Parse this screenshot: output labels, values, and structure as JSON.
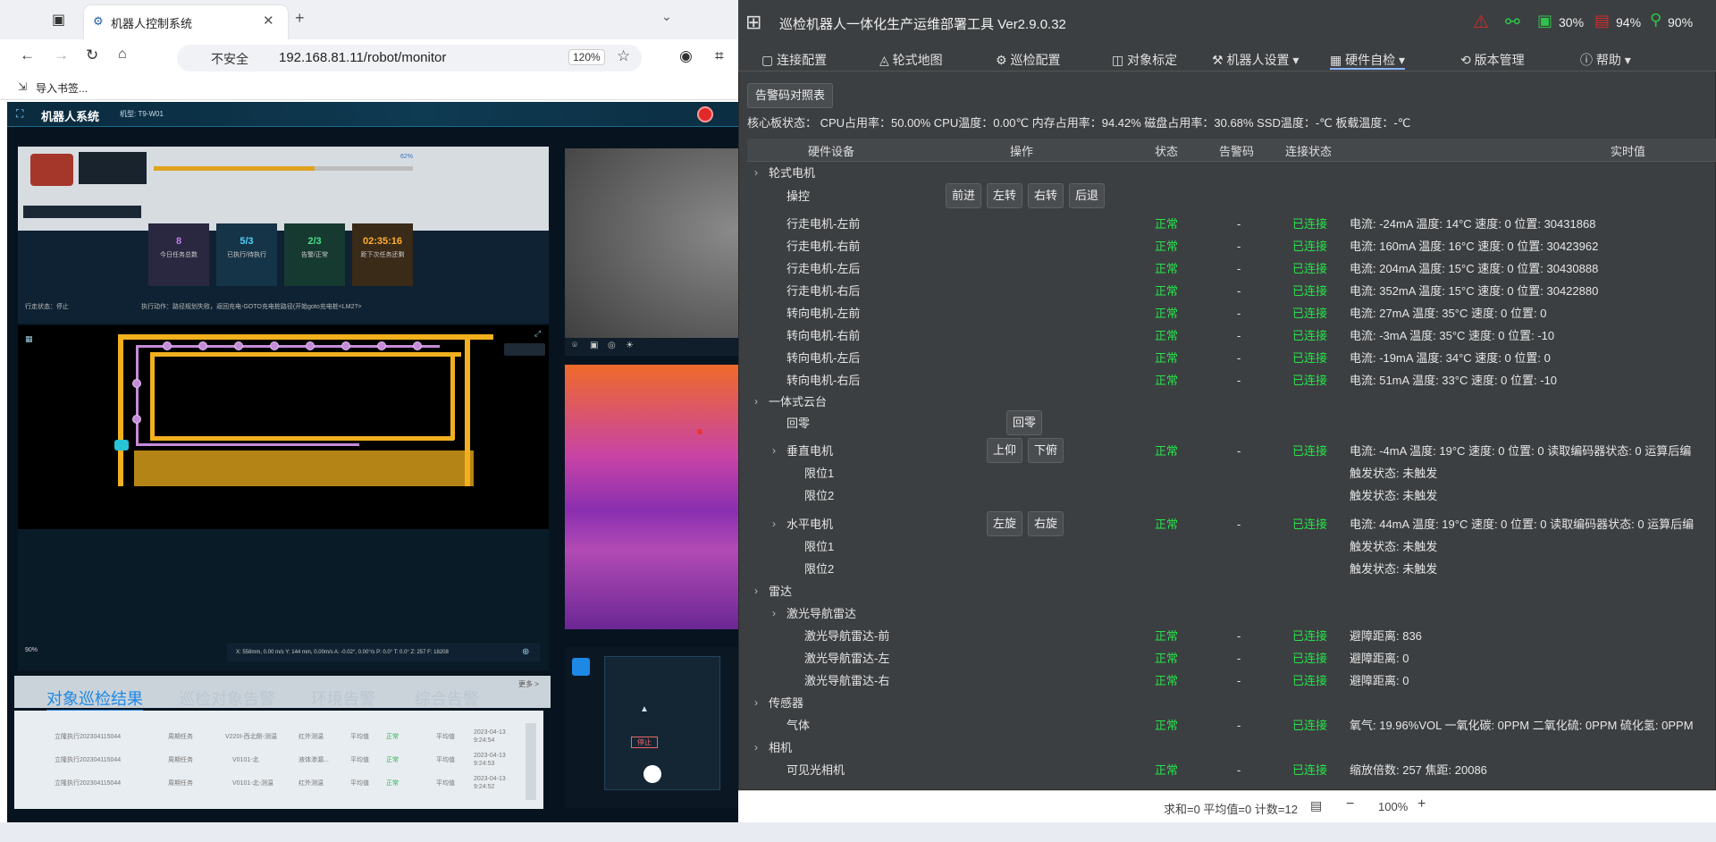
{
  "browser": {
    "tab_title": "机器人控制系统",
    "url_security": "不安全",
    "url": "192.168.81.11/robot/monitor",
    "zoom": "120%",
    "bookmarks_label": "导入书签..."
  },
  "webapp": {
    "title": "机器人系统",
    "model": "机型: T9-W01",
    "stats": [
      {
        "value": "8",
        "label": "今日任务总数",
        "color": "#c07cf0"
      },
      {
        "value": "5/3",
        "label": "已执行/待执行",
        "color": "#4fd2ff"
      },
      {
        "value": "2/3",
        "label": "告警/正常",
        "color": "#44e08a"
      },
      {
        "value": "02:35:16",
        "label": "距下次任务还剩",
        "color": "#ffae2c"
      }
    ],
    "battery_pct": "62%",
    "run_state": "行走状态：停止",
    "exec_action": "执行动作：路径规划失败，返回充电-GOTO充电桩路径(开始goto充电桩<LM2?>",
    "coord_readout": "X: 558mm,  0.00 m/s   Y: 144 mm,  0.00m/s   A: -0.02°,  0.00°/s   P: 0.0°   T: 0.0°   Z: 257   F: 18208",
    "signal": "90%",
    "bottom_tabs": [
      "对象巡检结果",
      "巡检对象告警",
      "环境告警",
      "综合告警"
    ],
    "more": "更多 >",
    "rows": [
      {
        "task": "立隆执行202304115044",
        "type": "周期任务",
        "obj": "V220I-西北侧-测温",
        "method": "红外测温",
        "judge": "平均值",
        "status": "正常",
        "level": "平均值",
        "time": "2023-04-13 9:24:54"
      },
      {
        "task": "立隆执行202304115044",
        "type": "周期任务",
        "obj": "V0101-北",
        "method": "液体渗漏...",
        "judge": "平均值",
        "status": "正常",
        "level": "平均值",
        "time": "2023-04-13 9:24:53"
      },
      {
        "task": "立隆执行202304115044",
        "type": "周期任务",
        "obj": "V0101-北-测温",
        "method": "红外测温",
        "judge": "平均值",
        "status": "正常",
        "level": "平均值",
        "time": "2023-04-13 9:24:52"
      }
    ]
  },
  "tool": {
    "title": "巡检机器人一体化生产运维部署工具  Ver2.9.0.32",
    "top_stats": {
      "cpu": "30%",
      "mem": "94%",
      "loc": "90%"
    },
    "menu": [
      "连接配置",
      "轮式地图",
      "巡检配置",
      "对象标定",
      "机器人设置",
      "硬件自检",
      "版本管理",
      "帮助"
    ],
    "alarm_btn": "告警码对照表",
    "core_status": "核心板状态：  CPU占用率：50.00%  CPU温度：0.00℃  内存占用率：94.42%  磁盘占用率：30.68%  SSD温度：-℃  板载温度：-℃",
    "headers": [
      "硬件设备",
      "操作",
      "状态",
      "告警码",
      "连接状态",
      "实时值"
    ],
    "ok": "正常",
    "connected": "已连接",
    "dash": "-",
    "groups": {
      "wheel": "轮式电机",
      "control": "操控",
      "btn_forward": "前进",
      "btn_left": "左转",
      "btn_right": "右转",
      "btn_back": "后退",
      "ptz": "一体式云台",
      "home": "回零",
      "btn_home": "回零",
      "vertical": "垂直电机",
      "btn_up": "上仰",
      "btn_down": "下俯",
      "limit1": "限位1",
      "limit2": "限位2",
      "trigger": "触发状态: 未触发",
      "horizontal": "水平电机",
      "btn_ccw": "左旋",
      "btn_cw": "右旋",
      "radar": "雷达",
      "laser": "激光导航雷达",
      "sensor": "传感器",
      "gas": "气体",
      "camera": "相机",
      "visible": "可见光相机"
    },
    "motors": [
      {
        "name": "行走电机-左前",
        "value": "电流: -24mA 温度: 14°C 速度: 0 位置: 30431868"
      },
      {
        "name": "行走电机-右前",
        "value": "电流: 160mA 温度: 16°C 速度: 0 位置: 30423962"
      },
      {
        "name": "行走电机-左后",
        "value": "电流: 204mA 温度: 15°C 速度: 0 位置: 30430888"
      },
      {
        "name": "行走电机-右后",
        "value": "电流: 352mA 温度: 15°C 速度: 0 位置: 30422880"
      },
      {
        "name": "转向电机-左前",
        "value": "电流: 27mA 温度: 35°C 速度: 0 位置: 0"
      },
      {
        "name": "转向电机-右前",
        "value": "电流: -3mA 温度: 35°C 速度: 0 位置: -10"
      },
      {
        "name": "转向电机-左后",
        "value": "电流: -19mA 温度: 34°C 速度: 0 位置: 0"
      },
      {
        "name": "转向电机-右后",
        "value": "电流: 51mA 温度: 33°C 速度: 0 位置: -10"
      }
    ],
    "vertical_value": "电流: -4mA 温度: 19°C 速度: 0 位置: 0 读取编码器状态: 0 运算后编",
    "horizontal_value": "电流: 44mA 温度: 19°C 速度: 0 位置: 0 读取编码器状态: 0 运算后编",
    "lidars": [
      {
        "name": "激光导航雷达-前",
        "value": "避障距离: 836"
      },
      {
        "name": "激光导航雷达-左",
        "value": "避障距离: 0"
      },
      {
        "name": "激光导航雷达-右",
        "value": "避障距离: 0"
      }
    ],
    "gas_value": "氧气: 19.96%VOL 一氧化碳: 0PPM 二氧化硫: 0PPM 硫化氢: 0PPM",
    "camera_value": "缩放倍数: 257 焦距: 20086",
    "statusbar": "求和=0 平均值=0 计数=12",
    "statusbar_zoom": "100%"
  }
}
